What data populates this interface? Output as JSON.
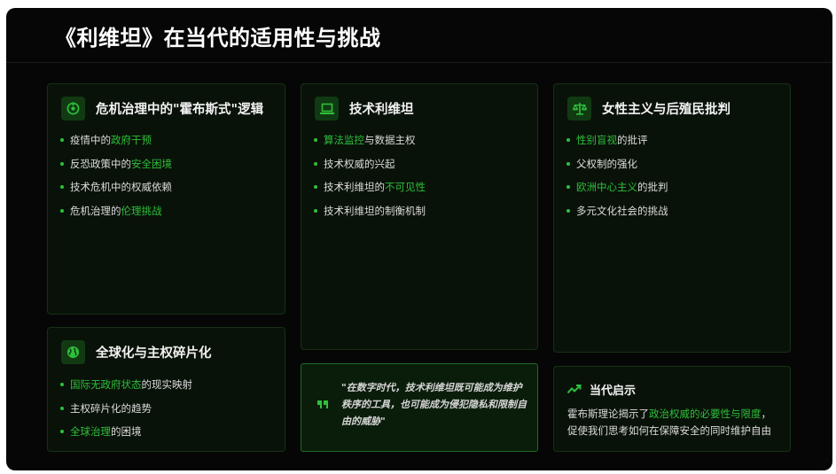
{
  "title": "《利维坦》在当代的适用性与挑战",
  "cards": {
    "crisis": {
      "icon": "radiation-icon",
      "title": "危机治理中的\"霍布斯式\"逻辑",
      "items": [
        {
          "a": "疫情中的",
          "b": "政府干预",
          "c": ""
        },
        {
          "a": "反恐政策中的",
          "b": "安全困境",
          "c": ""
        },
        {
          "a": "技术危机中的权威依赖",
          "b": "",
          "c": ""
        },
        {
          "a": "危机治理的",
          "b": "伦理挑战",
          "c": ""
        }
      ]
    },
    "tech": {
      "icon": "laptop-icon",
      "title": "技术利维坦",
      "items": [
        {
          "a": "",
          "b": "算法监控",
          "c": "与数据主权"
        },
        {
          "a": "技术权威的兴起",
          "b": "",
          "c": ""
        },
        {
          "a": "技术利维坦的",
          "b": "不可见性",
          "c": ""
        },
        {
          "a": "技术利维坦的制衡机制",
          "b": "",
          "c": ""
        }
      ]
    },
    "feminism": {
      "icon": "scales-icon",
      "title": "女性主义与后殖民批判",
      "items": [
        {
          "a": "",
          "b": "性别盲视",
          "c": "的批评"
        },
        {
          "a": "父权制的强化",
          "b": "",
          "c": ""
        },
        {
          "a": "",
          "b": "欧洲中心主义",
          "c": "的批判"
        },
        {
          "a": "多元文化社会的挑战",
          "b": "",
          "c": ""
        }
      ]
    },
    "globalization": {
      "icon": "globe-icon",
      "title": "全球化与主权碎片化",
      "items": [
        {
          "a": "",
          "b": "国际无政府状态",
          "c": "的现实映射"
        },
        {
          "a": "主权碎片化的趋势",
          "b": "",
          "c": ""
        },
        {
          "a": "",
          "b": "全球治理",
          "c": "的困境"
        }
      ]
    }
  },
  "quote": {
    "icon": "quote-icon",
    "text": "\"在数字时代，技术利维坦既可能成为维护秩序的工具，也可能成为侵犯隐私和限制自由的威胁\""
  },
  "insight": {
    "icon": "trend-icon",
    "title": "当代启示",
    "text_a": "霍布斯理论揭示了",
    "text_b": "政治权威的必要性与限度",
    "text_c": "，促使我们思考如何在保障安全的同时维护自由"
  },
  "colors": {
    "accent": "#2fbf3b",
    "background": "#060606",
    "card": "#091209",
    "border": "#163016"
  }
}
